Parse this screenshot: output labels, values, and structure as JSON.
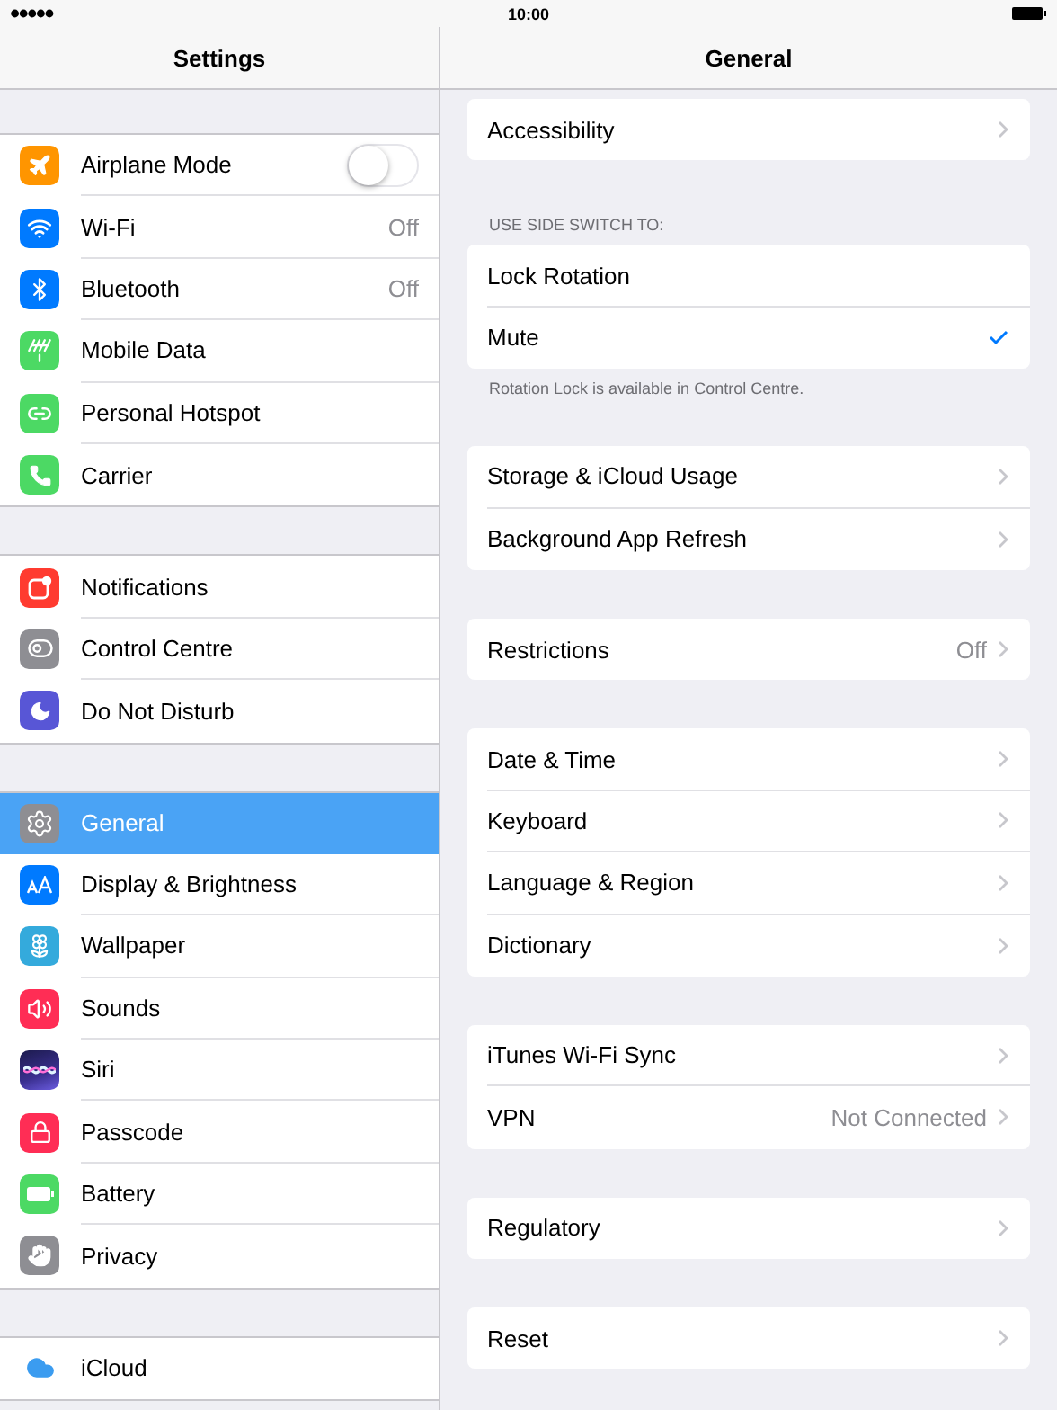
{
  "status_bar": {
    "time": "10:00"
  },
  "sidebar": {
    "title": "Settings",
    "groups": [
      {
        "items": [
          {
            "label": "Airplane Mode",
            "kind": "toggle",
            "on": false,
            "selected": false
          },
          {
            "label": "Wi-Fi",
            "value": "Off",
            "kind": "link",
            "selected": false
          },
          {
            "label": "Bluetooth",
            "value": "Off",
            "kind": "link",
            "selected": false
          },
          {
            "label": "Mobile Data",
            "kind": "link",
            "selected": false
          },
          {
            "label": "Personal Hotspot",
            "kind": "link",
            "selected": false
          },
          {
            "label": "Carrier",
            "kind": "link",
            "selected": false
          }
        ]
      },
      {
        "items": [
          {
            "label": "Notifications",
            "kind": "link",
            "selected": false
          },
          {
            "label": "Control Centre",
            "kind": "link",
            "selected": false
          },
          {
            "label": "Do Not Disturb",
            "kind": "link",
            "selected": false
          }
        ]
      },
      {
        "items": [
          {
            "label": "General",
            "kind": "link",
            "selected": true
          },
          {
            "label": "Display & Brightness",
            "kind": "link",
            "selected": false
          },
          {
            "label": "Wallpaper",
            "kind": "link",
            "selected": false
          },
          {
            "label": "Sounds",
            "kind": "link",
            "selected": false
          },
          {
            "label": "Siri",
            "kind": "link",
            "selected": false
          },
          {
            "label": "Passcode",
            "kind": "link",
            "selected": false
          },
          {
            "label": "Battery",
            "kind": "link",
            "selected": false
          },
          {
            "label": "Privacy",
            "kind": "link",
            "selected": false
          }
        ]
      },
      {
        "items": [
          {
            "label": "iCloud",
            "kind": "link",
            "selected": false
          }
        ]
      }
    ]
  },
  "detail": {
    "title": "General",
    "sections": [
      {
        "rows": [
          {
            "kind": "link",
            "label": "Accessibility"
          }
        ]
      },
      {
        "header": "USE SIDE SWITCH TO:",
        "rows": [
          {
            "kind": "option",
            "label": "Lock Rotation",
            "selected": false
          },
          {
            "kind": "option",
            "label": "Mute",
            "selected": true
          }
        ],
        "footer": "Rotation Lock is available in Control Centre."
      },
      {
        "rows": [
          {
            "kind": "link",
            "label": "Storage & iCloud Usage"
          },
          {
            "kind": "link",
            "label": "Background App Refresh"
          }
        ]
      },
      {
        "rows": [
          {
            "kind": "link",
            "label": "Restrictions",
            "value": "Off"
          }
        ]
      },
      {
        "rows": [
          {
            "kind": "link",
            "label": "Date & Time"
          },
          {
            "kind": "link",
            "label": "Keyboard"
          },
          {
            "kind": "link",
            "label": "Language & Region"
          },
          {
            "kind": "link",
            "label": "Dictionary"
          }
        ]
      },
      {
        "rows": [
          {
            "kind": "link",
            "label": "iTunes Wi-Fi Sync"
          },
          {
            "kind": "link",
            "label": "VPN",
            "value": "Not Connected"
          }
        ]
      },
      {
        "rows": [
          {
            "kind": "link",
            "label": "Regulatory"
          }
        ]
      },
      {
        "rows": [
          {
            "kind": "link",
            "label": "Reset"
          }
        ]
      }
    ]
  }
}
